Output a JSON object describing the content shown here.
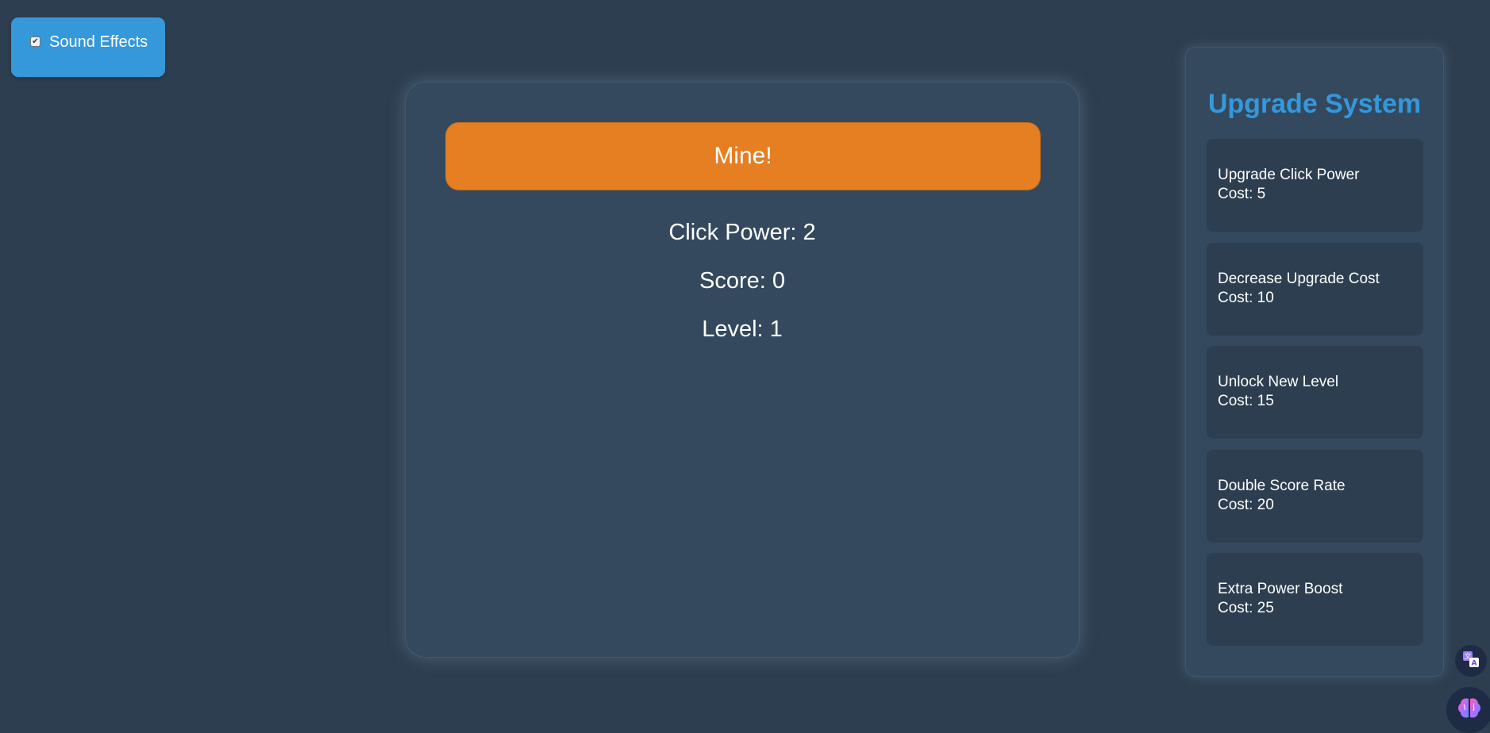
{
  "settings": {
    "sound_effects_label": "Sound Effects",
    "sound_effects_checked": true
  },
  "game": {
    "mine_button_label": "Mine!",
    "click_power": "Click Power: 2",
    "score": "Score: 0",
    "level": "Level: 1"
  },
  "upgrades": {
    "title": "Upgrade System",
    "items": [
      {
        "name": "Upgrade Click Power",
        "cost": "Cost: 5"
      },
      {
        "name": "Decrease Upgrade Cost",
        "cost": "Cost: 10"
      },
      {
        "name": "Unlock New Level",
        "cost": "Cost: 15"
      },
      {
        "name": "Double Score Rate",
        "cost": "Cost: 20"
      },
      {
        "name": "Extra Power Boost",
        "cost": "Cost: 25"
      }
    ]
  },
  "colors": {
    "background": "#2d3e50",
    "panel": "#34495e",
    "card": "#2c3e50",
    "accent_blue": "#3498db",
    "accent_orange": "#e67e22"
  },
  "icons": {
    "translate": "translate-icon",
    "brain": "brain-icon"
  }
}
